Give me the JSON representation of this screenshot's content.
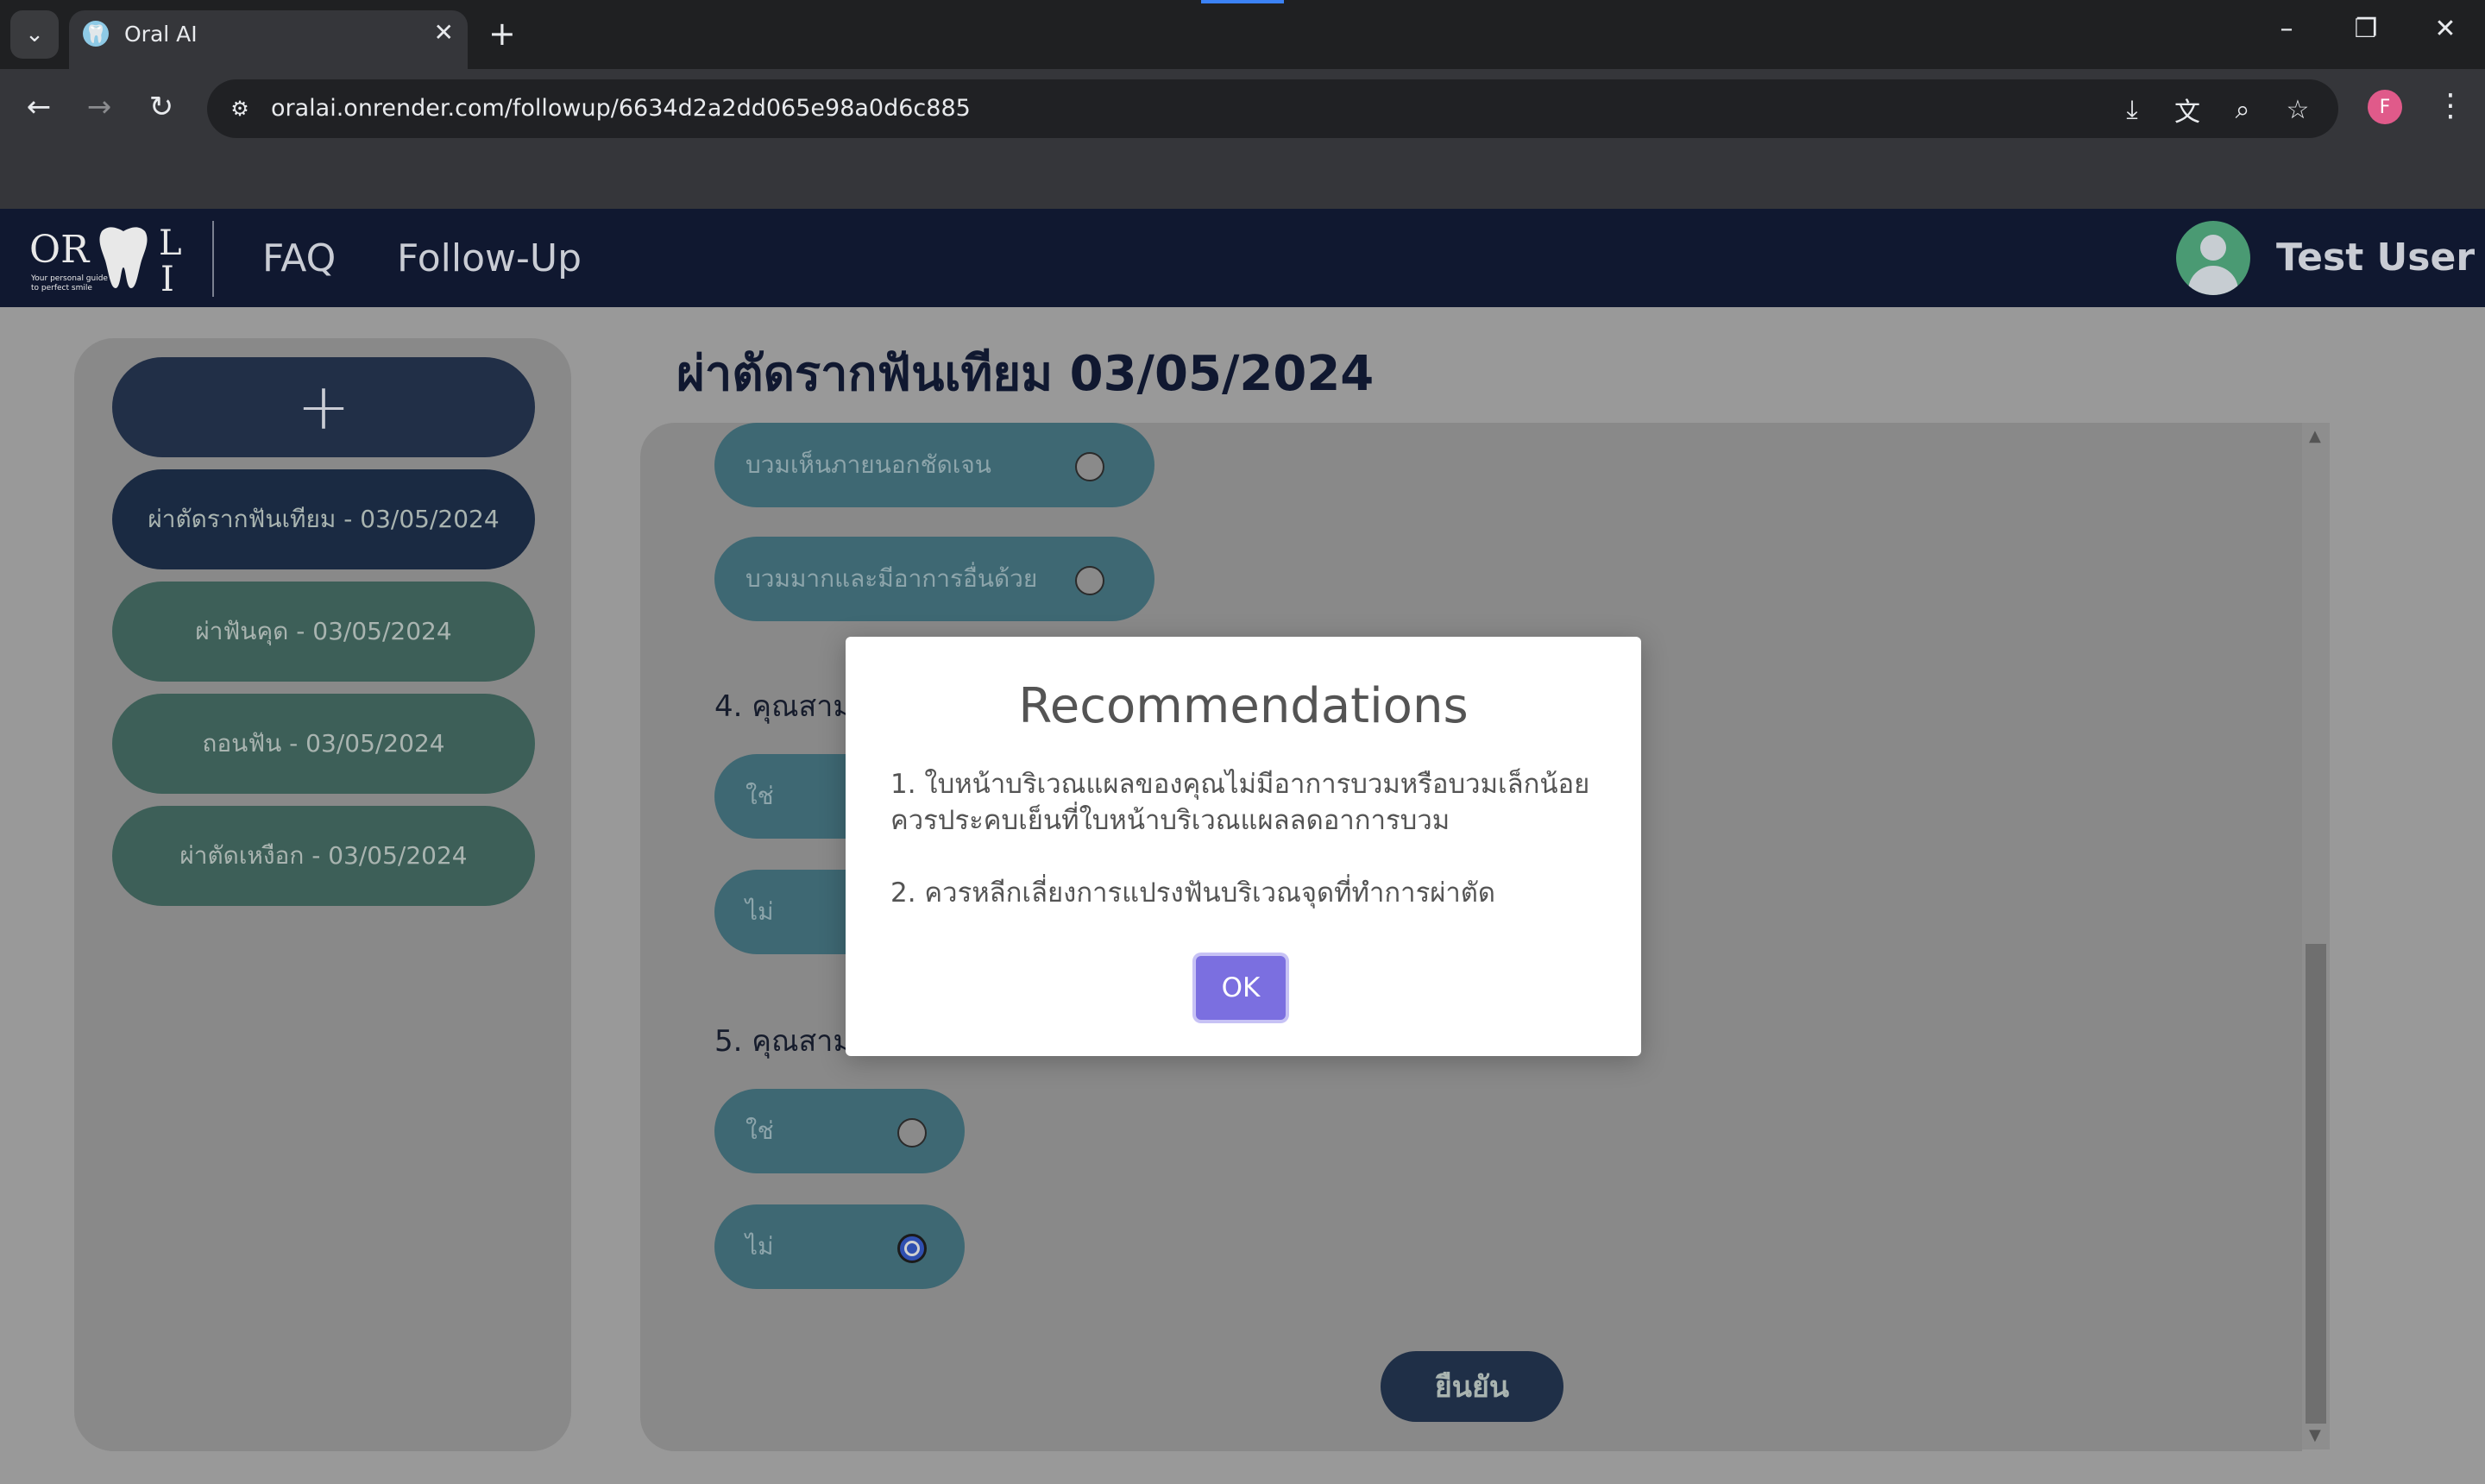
{
  "browser": {
    "tab_title": "Oral AI",
    "url": "oralai.onrender.com/followup/6634d2a2dd065e98a0d6c885",
    "profile_initial": "F"
  },
  "navbar": {
    "logo_or": "OR",
    "logo_l": "L",
    "logo_i": "I",
    "logo_tagline": "Your personal guide to perfect smile",
    "links": [
      "FAQ",
      "Follow-Up"
    ],
    "user_name": "Test User"
  },
  "sidebar": {
    "add_label": "+",
    "items": [
      "ผ่าตัดรากฟันเทียม - 03/05/2024",
      "ผ่าฟันคุด - 03/05/2024",
      "ถอนฟัน - 03/05/2024",
      "ผ่าตัดเหงือก - 03/05/2024"
    ]
  },
  "main": {
    "title": "ผ่าตัดรากฟันเทียม 03/05/2024",
    "top_options": [
      "บวมเห็นภายนอกชัดเจน",
      "บวมมากและมีอาการอื่นด้วย"
    ],
    "q4": {
      "label": "4. คุณสาม",
      "options": [
        "ใช่",
        "ไม่"
      ]
    },
    "q5": {
      "label": "5. คุณสาม",
      "options": [
        "ใช่",
        "ไม่"
      ],
      "selected": "ไม่"
    },
    "confirm_label": "ยืนยัน"
  },
  "modal": {
    "title": "Recommendations",
    "line1": "1. ใบหน้าบริเวณแผลของคุณไม่มีอาการบวมหรือบวมเล็กน้อย",
    "line2": "ควรประคบเย็นที่ใบหน้าบริเวณแผลลดอาการบวม",
    "line3": "2. ควรหลีกเลี่ยงการแปรงฟันบริเวณจุดที่ทำการผ่าตัด",
    "ok_label": "OK"
  },
  "colors": {
    "navbar": "#101830",
    "sidebar_active": "#1a2a42",
    "sidebar_item": "#3d5f58",
    "option_pill": "#3e6873",
    "ok_button": "#7b6fe0"
  }
}
